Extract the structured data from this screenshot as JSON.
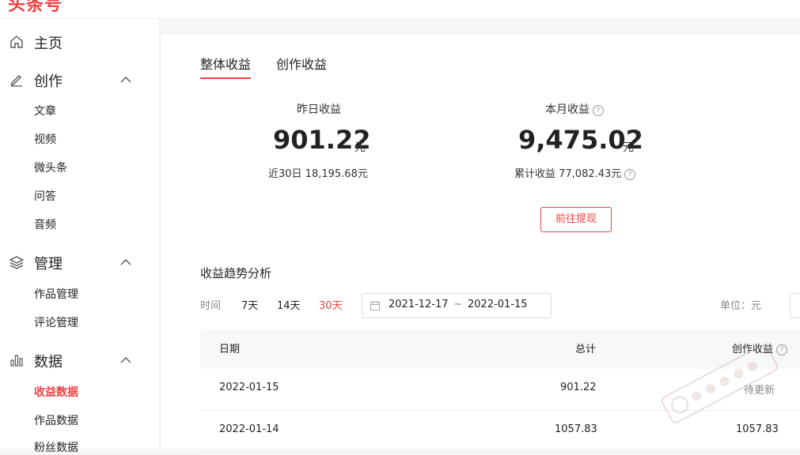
{
  "app": {
    "logo": "头条号",
    "accent": "#f04142"
  },
  "sidebar": {
    "home": {
      "label": "主页",
      "icon": "home-icon"
    },
    "create": {
      "label": "创作",
      "icon": "pencil-icon",
      "items": [
        "文章",
        "视频",
        "微头条",
        "问答",
        "音频"
      ]
    },
    "manage": {
      "label": "管理",
      "icon": "layers-icon",
      "items": [
        "作品管理",
        "评论管理"
      ]
    },
    "data": {
      "label": "数据",
      "icon": "bar-chart-icon",
      "items": [
        "收益数据",
        "作品数据",
        "粉丝数据"
      ],
      "active": "收益数据"
    }
  },
  "tabs": [
    "整体收益",
    "创作收益"
  ],
  "stats": {
    "yesterday": {
      "label": "昨日收益",
      "value": "901.22",
      "unit": "元",
      "sub": "近30日 18,195.68元"
    },
    "month": {
      "label": "本月收益",
      "value": "9,475.02",
      "unit": "元",
      "sub": "累计收益 77,082.43元"
    }
  },
  "withdraw_label": "前往提现",
  "trend": {
    "title": "收益趋势分析",
    "time_label": "时间",
    "ranges": [
      "7天",
      "14天",
      "30天"
    ],
    "active_range": "30天",
    "date_start": "2021-12-17",
    "date_sep": "~",
    "date_end": "2022-01-15",
    "unit_label": "单位：元"
  },
  "table": {
    "headers": [
      "日期",
      "总计",
      "创作收益"
    ],
    "rows": [
      [
        "2022-01-15",
        "901.22",
        "待更新"
      ],
      [
        "2022-01-14",
        "1057.83",
        "1057.83"
      ]
    ]
  }
}
